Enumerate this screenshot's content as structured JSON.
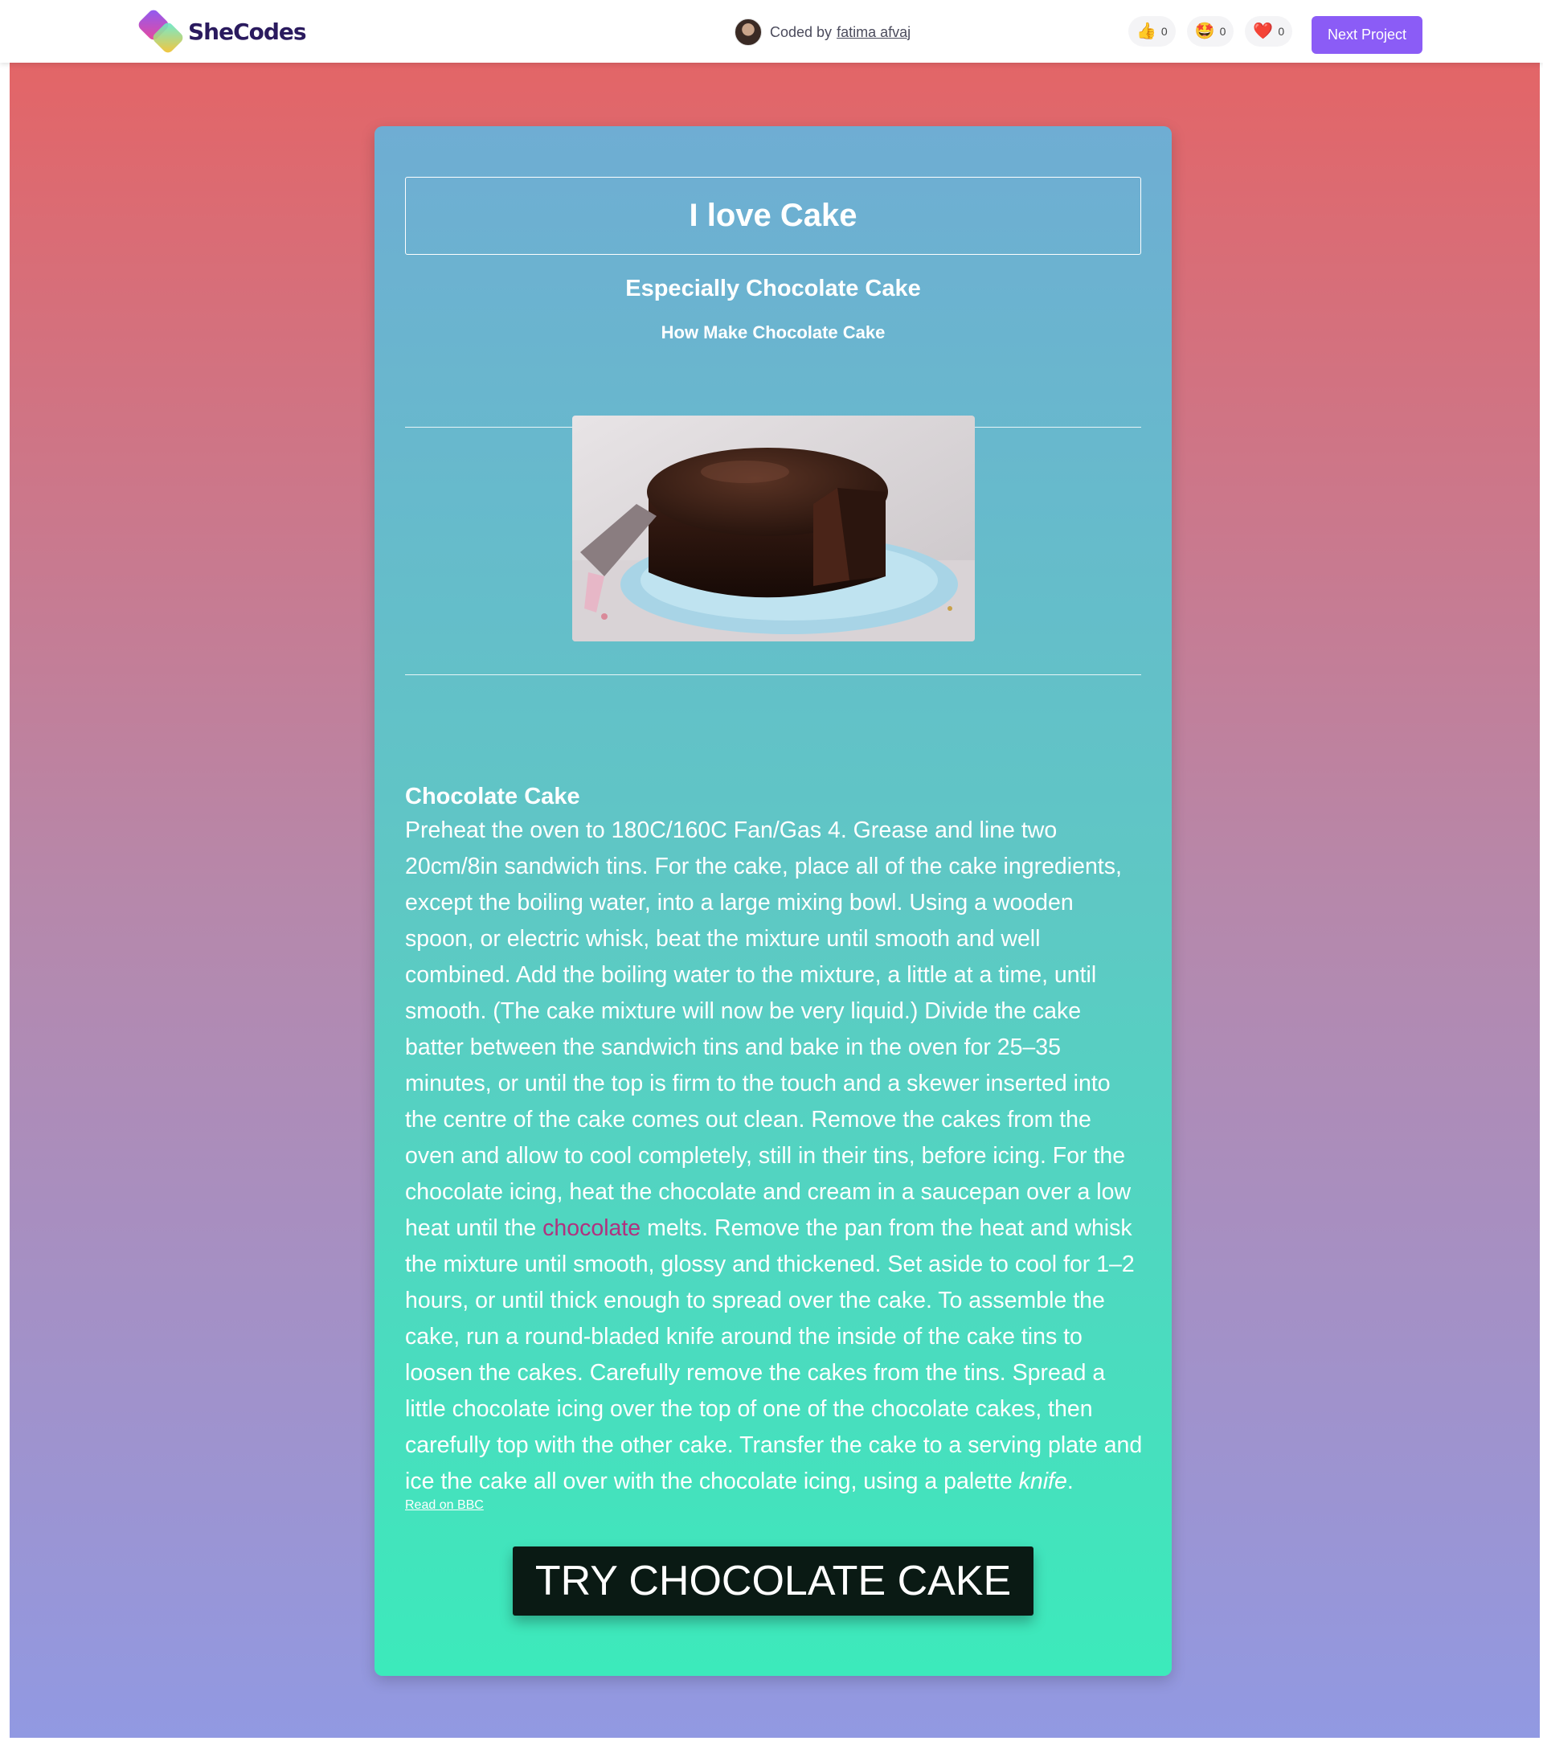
{
  "topbar": {
    "brand": "SheCodes",
    "coded_by_prefix": "Coded by",
    "author": "fatima afvaj",
    "reactions": [
      {
        "icon": "thumbs-up-icon",
        "glyph": "👍",
        "count": "0"
      },
      {
        "icon": "star-struck-icon",
        "glyph": "🤩",
        "count": "0"
      },
      {
        "icon": "heart-icon",
        "glyph": "❤️",
        "count": "0"
      }
    ],
    "next_label": "Next Project"
  },
  "card": {
    "title": "I love Cake",
    "subtitle": "Especially Chocolate Cake",
    "subsubtitle": "How Make Chocolate Cake",
    "image": "chocolate cake on blue plate",
    "recipe_heading": "Chocolate Cake",
    "recipe_before": "Preheat the oven to 180C/160C Fan/Gas 4. Grease and line two 20cm/8in sandwich tins. For the cake, place all of the cake ingredients, except the boiling water, into a large mixing bowl. Using a wooden spoon, or electric whisk, beat the mixture until smooth and well combined. Add the boiling water to the mixture, a little at a time, until smooth. (The cake mixture will now be very liquid.) Divide the cake batter between the sandwich tins and bake in the oven for 25–35 minutes, or until the top is firm to the touch and a skewer inserted into the centre of the cake comes out clean. Remove the cakes from the oven and allow to cool completely, still in their tins, before icing. For the chocolate icing, heat the chocolate and cream in a saucepan over a low heat until the ",
    "recipe_highlight": "chocolate",
    "recipe_after": " melts. Remove the pan from the heat and whisk the mixture until smooth, glossy and thickened. Set aside to cool for 1–2 hours, or until thick enough to spread over the cake. To assemble the cake, run a round-bladed knife around the inside of the cake tins to loosen the cakes. Carefully remove the cakes from the tins. Spread a little chocolate icing over the top of one of the chocolate cakes, then carefully top with the other cake. Transfer the cake to a serving plate and ice the cake all over with the chocolate icing, using a palette ",
    "recipe_italic": "knife",
    "recipe_end": ".",
    "read_link": "Read on BBC",
    "cta": "TRY CHOCOLATE CAKE"
  },
  "colors": {
    "accent": "#8b5cf6",
    "highlight": "#b0327f",
    "page_gradient_top": "#e36567",
    "page_gradient_bottom": "#9199e2",
    "card_gradient_top": "#6fadd3",
    "card_gradient_bottom": "#3ceabb"
  }
}
